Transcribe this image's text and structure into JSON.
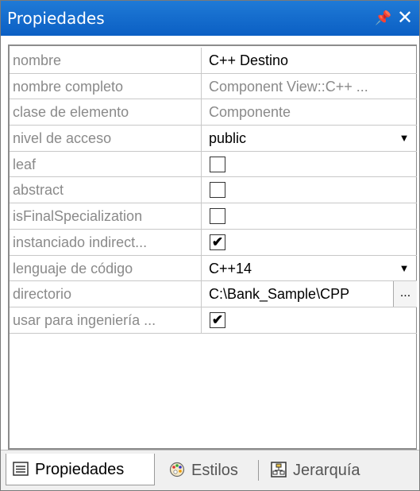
{
  "panel": {
    "title": "Propiedades"
  },
  "properties": [
    {
      "label": "nombre",
      "value": "C++ Destino",
      "type": "text",
      "editable": true
    },
    {
      "label": "nombre completo",
      "value": "Component View::C++ ...",
      "type": "text",
      "editable": false
    },
    {
      "label": "clase de elemento",
      "value": "Componente",
      "type": "text",
      "editable": false
    },
    {
      "label": "nivel de acceso",
      "value": "public",
      "type": "dropdown",
      "editable": true
    },
    {
      "label": "leaf",
      "value": "",
      "type": "checkbox",
      "checked": false
    },
    {
      "label": "abstract",
      "value": "",
      "type": "checkbox",
      "checked": false
    },
    {
      "label": "isFinalSpecialization",
      "value": "",
      "type": "checkbox",
      "checked": false
    },
    {
      "label": "instanciado indirect...",
      "value": "",
      "type": "checkbox",
      "checked": true
    },
    {
      "label": "lenguaje de código",
      "value": "C++14",
      "type": "dropdown",
      "editable": true
    },
    {
      "label": "directorio",
      "value": "C:\\Bank_Sample\\CPP",
      "type": "browse",
      "editable": true,
      "button": "..."
    },
    {
      "label": "usar para ingeniería ...",
      "value": "",
      "type": "checkbox",
      "checked": true
    }
  ],
  "tabs": [
    {
      "label": "Propiedades",
      "icon": "properties-icon",
      "active": true
    },
    {
      "label": "Estilos",
      "icon": "palette-icon",
      "active": false
    },
    {
      "label": "Jerarquía",
      "icon": "hierarchy-icon",
      "active": false
    }
  ],
  "colors": {
    "titlebar": "#0b5fc4",
    "label_text": "#8a8a8a",
    "grid_line": "#c8c8c8"
  }
}
